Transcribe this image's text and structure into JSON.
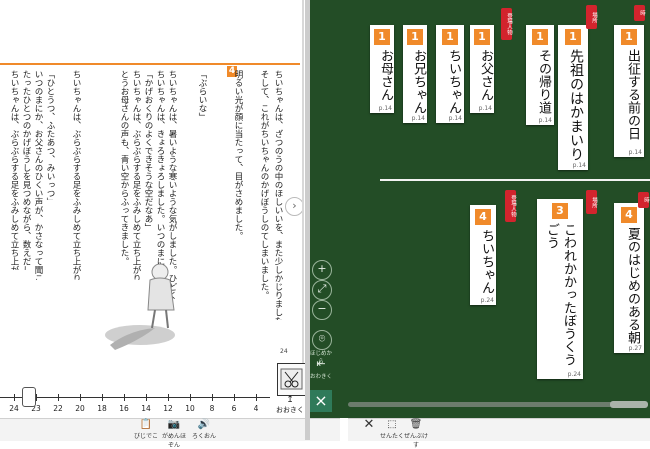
{
  "left_page": {
    "section_number": "4",
    "page_number": "24",
    "text_columns": [
      "ちいちゃんは、ぶらぶらする足をふみしめて立ち上がりました。",
      "たったひとつのかげぼうしを見つめながら、数えだしました。",
      "いつのまにか、お父さんのひくい声が、かさなって聞こえだしました。",
      "「ひとうつ、ふたあつ、みいっつ」",
      "ちいちゃんは、ぶらぶらする足をふみしめて立ち上がりました。",
      "",
      "とうお母さんの声も、青い空からふってきました。",
      "ちいちゃんは、ぶらぶらする足をふみしめて立ち上がりました。",
      "「かげおくりのよくできそうな空だなあ」",
      "ちいちゃんは、きょろきょろしました。いつのまにか、太陽は、高く上がっていました。",
      "ちいちゃんは、暑いような寒いような気がしました。ひどくのどがかわいています。",
      "「ぶらいな」",
      "明るい光が顔に当たって、目がさめました。",
      "そして、これがちいちゃんのかげぼうしのてしまいました。",
      "ちいちゃんは、ざつのうの中のほしいいを、また少しかじりました。"
    ],
    "illustration": "girl-figure",
    "next_page_arrow": "›"
  },
  "slider": {
    "ticks": [
      "24",
      "23",
      "22",
      "20",
      "18",
      "16",
      "14",
      "12",
      "10",
      "8",
      "6",
      "4"
    ],
    "current": "23"
  },
  "okiku_label": "おおきく",
  "bottom_left_tools": [
    {
      "icon": "clipboard-icon",
      "label": "びじでこ"
    },
    {
      "icon": "camera-icon",
      "label": "がめんほぞん"
    },
    {
      "icon": "audio-icon",
      "label": "ろくおん"
    }
  ],
  "board": {
    "cards_top": [
      {
        "num": "1",
        "text": "お母さん",
        "page": "p.14",
        "tag": ""
      },
      {
        "num": "1",
        "text": "お兄ちゃん",
        "page": "p.14",
        "tag": ""
      },
      {
        "num": "1",
        "text": "ちいちゃん",
        "page": "p.14",
        "tag": ""
      },
      {
        "num": "1",
        "text": "お父さん",
        "page": "p.14",
        "tag": "登場人物"
      },
      {
        "num": "1",
        "text": "その帰り道",
        "page": "p.14",
        "tag": ""
      },
      {
        "num": "1",
        "text": "先祖のはかまいり",
        "page": "p.14",
        "tag": "場所"
      },
      {
        "num": "1",
        "text": "出征する前の日",
        "page": "p.14",
        "tag": "時"
      }
    ],
    "cards_bottom": [
      {
        "num": "4",
        "text": "ちいちゃん",
        "page": "p.24",
        "tag": "登場人物"
      },
      {
        "num": "3",
        "text": "こわれかかったぼうくうごう",
        "page": "p.24",
        "tag": "場所"
      },
      {
        "num": "4",
        "text": "夏のはじめのある朝",
        "page": "p.27",
        "tag": "時"
      }
    ],
    "side_tools": [
      {
        "icon": "zoom-in-icon",
        "label": ""
      },
      {
        "icon": "fit-icon",
        "label": ""
      },
      {
        "icon": "zoom-out-icon",
        "label": ""
      },
      {
        "icon": "pin-icon",
        "label": "ほじめから"
      },
      {
        "icon": "arrow-left-icon",
        "label": "おわきく"
      }
    ],
    "close_glyph": "×",
    "bottom_tools": [
      {
        "icon": "close-icon",
        "label": ""
      },
      {
        "icon": "select-icon",
        "label": "せんたく"
      },
      {
        "icon": "trash-icon",
        "label": "ぜんぶけす"
      }
    ]
  },
  "colors": {
    "board": "#234d26",
    "accent": "#f08a2a",
    "tag": "#d2242d"
  }
}
